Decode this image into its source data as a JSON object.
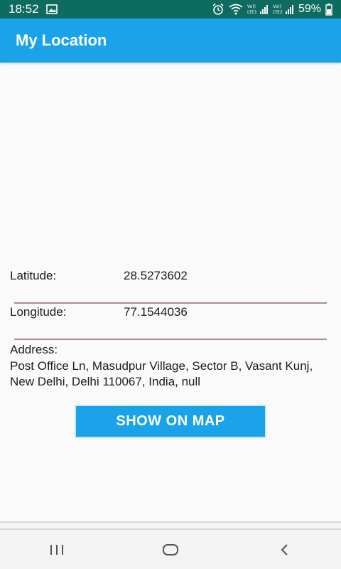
{
  "status_bar": {
    "time": "18:52",
    "battery": "59%",
    "icons": [
      "image-icon",
      "alarm-icon",
      "wifi-icon",
      "volte-lte1-signal-icon",
      "volte-lte2-signal-icon",
      "battery-icon"
    ]
  },
  "app_bar": {
    "title": "My Location"
  },
  "location": {
    "latitude_label": "Latitude:",
    "latitude_value": "28.5273602",
    "longitude_label": "Longitude:",
    "longitude_value": "77.1544036",
    "address_label": "Address:",
    "address_value": "Post Office Ln, Masudpur Village, Sector B, Vasant Kunj, New Delhi, Delhi 110067, India, null"
  },
  "actions": {
    "show_on_map_label": "SHOW ON MAP"
  },
  "nav_bar": {
    "icons": [
      "recent-apps-icon",
      "home-icon",
      "back-icon"
    ]
  },
  "colors": {
    "status_bar": "#0e6b5f",
    "app_bar": "#1aa3e8",
    "button": "#1aa3e8",
    "underline": "#a78e8e",
    "background": "#fafafa"
  }
}
